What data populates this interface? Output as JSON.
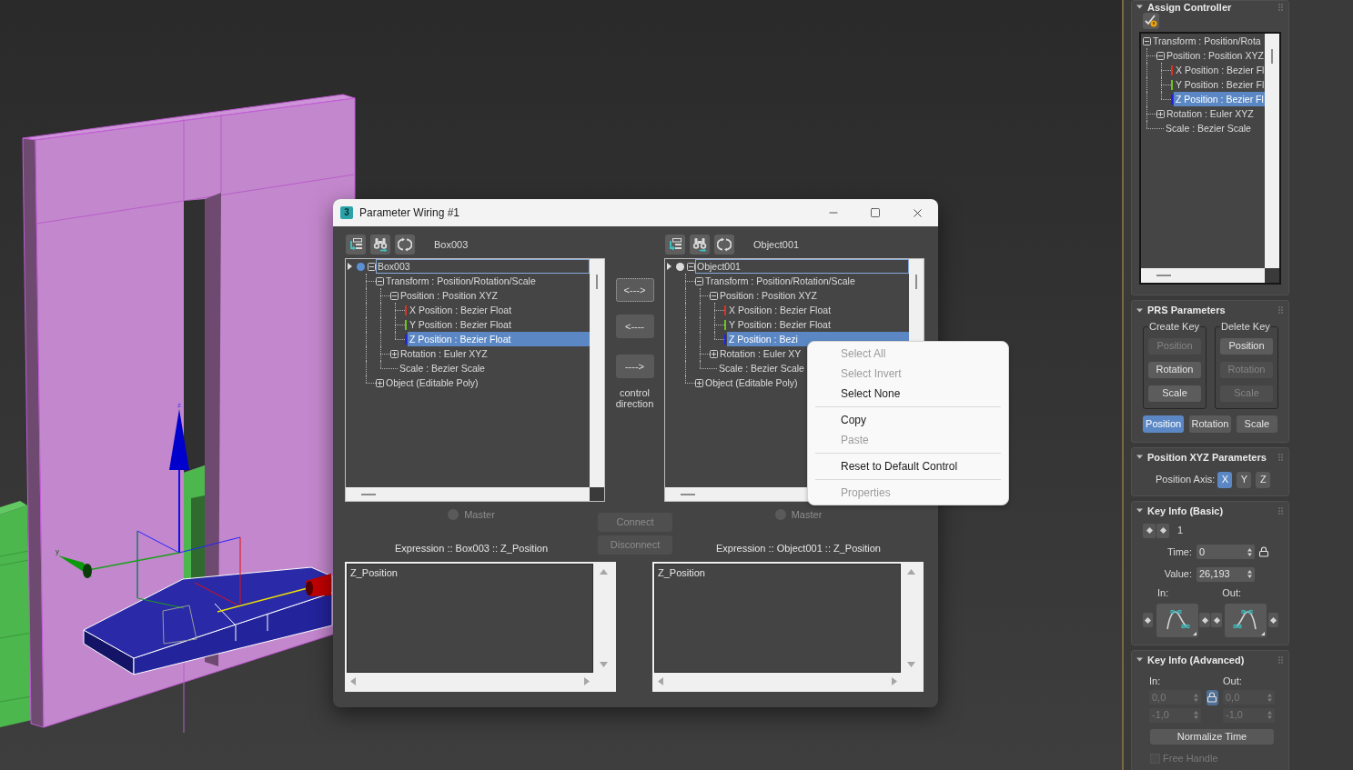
{
  "viewport": {
    "gizmo_labels": [
      "z",
      "y"
    ]
  },
  "dialog": {
    "app_icon": "3",
    "title": "Parameter Wiring #1",
    "panes": [
      {
        "object_name": "Box003",
        "tree": {
          "label": "Box003",
          "kind": "object",
          "color": "#5b8fd6",
          "expanded": true,
          "selected": false,
          "focused": true,
          "children": [
            {
              "label": "Transform : Position/Rotation/Scale",
              "kind": "group",
              "expanded": true,
              "selected": false,
              "focused": false,
              "children": [
                {
                  "label": "Position : Position XYZ",
                  "kind": "group",
                  "expanded": true,
                  "selected": false,
                  "focused": false,
                  "children": [
                    {
                      "label": "X Position : Bezier Float",
                      "kind": "axis",
                      "color": "#e0301e",
                      "selected": false,
                      "focused": false
                    },
                    {
                      "label": "Y Position : Bezier Float",
                      "kind": "axis",
                      "color": "#6ec21e",
                      "selected": false,
                      "focused": false
                    },
                    {
                      "label": "Z Position : Bezier Float",
                      "kind": "axis",
                      "color": "#1e1eff",
                      "selected": true,
                      "focused": false
                    }
                  ]
                },
                {
                  "label": "Rotation : Euler XYZ",
                  "kind": "group",
                  "expanded": false,
                  "selected": false,
                  "focused": false
                },
                {
                  "label": "Scale : Bezier Scale",
                  "kind": "leaf",
                  "selected": false,
                  "focused": false
                }
              ]
            },
            {
              "label": "Object (Editable Poly)",
              "kind": "group",
              "expanded": false,
              "selected": false,
              "focused": false
            }
          ]
        },
        "master": {
          "label": "Master",
          "selected": false,
          "disabled": true
        },
        "expression_label": "Expression :: Box003 :: Z_Position",
        "expression": "Z_Position"
      },
      {
        "object_name": "Object001",
        "tree": {
          "label": "Object001",
          "kind": "object",
          "color": "#dcdcdc",
          "expanded": true,
          "selected": false,
          "focused": true,
          "children": [
            {
              "label": "Transform : Position/Rotation/Scale",
              "kind": "group",
              "expanded": true,
              "selected": false,
              "focused": false,
              "children": [
                {
                  "label": "Position : Position XYZ",
                  "kind": "group",
                  "expanded": true,
                  "selected": false,
                  "focused": false,
                  "children": [
                    {
                      "label": "X Position : Bezier Float",
                      "kind": "axis",
                      "color": "#e0301e",
                      "selected": false,
                      "focused": false
                    },
                    {
                      "label": "Y Position : Bezier Float",
                      "kind": "axis",
                      "color": "#6ec21e",
                      "selected": false,
                      "focused": false
                    },
                    {
                      "label": "Z Position : Bezi",
                      "kind": "axis",
                      "color": "#1e1eff",
                      "selected": true,
                      "focused": false
                    }
                  ]
                },
                {
                  "label": "Rotation : Euler XY",
                  "kind": "group",
                  "expanded": false,
                  "selected": false,
                  "focused": false
                },
                {
                  "label": "Scale : Bezier Scale",
                  "kind": "leaf",
                  "selected": false,
                  "focused": false
                }
              ]
            },
            {
              "label": "Object (Editable Poly)",
              "kind": "group",
              "expanded": false,
              "selected": false,
              "focused": false
            }
          ]
        },
        "master": {
          "label": "Master",
          "selected": false,
          "disabled": true
        },
        "expression_label": "Expression :: Object001 :: Z_Position",
        "expression": "Z_Position"
      }
    ],
    "direction_buttons": [
      {
        "label": "<--->",
        "focused": true
      },
      {
        "label": "<----",
        "focused": false
      },
      {
        "label": "---->",
        "focused": false
      }
    ],
    "direction_caption": "control direction",
    "connect_buttons": [
      {
        "label": "Connect",
        "disabled": true
      },
      {
        "label": "Disconnect",
        "disabled": true
      }
    ]
  },
  "context_menu": {
    "items": [
      {
        "kind": "item",
        "label": "Select All",
        "disabled": true
      },
      {
        "kind": "item",
        "label": "Select Invert",
        "disabled": true
      },
      {
        "kind": "item",
        "label": "Select None",
        "disabled": false
      },
      {
        "kind": "separator"
      },
      {
        "kind": "item",
        "label": "Copy",
        "disabled": false
      },
      {
        "kind": "item",
        "label": "Paste",
        "disabled": true
      },
      {
        "kind": "separator"
      },
      {
        "kind": "item",
        "label": "Reset to Default Control",
        "disabled": false
      },
      {
        "kind": "separator"
      },
      {
        "kind": "item",
        "label": "Properties",
        "disabled": true
      }
    ]
  },
  "command_panel": {
    "rollouts": [
      {
        "kind": "assign_controller",
        "title": "Assign Controller",
        "expanded": true,
        "tree": {
          "label": "Transform : Position/Rota",
          "kind": "group",
          "expanded": true,
          "selected": false,
          "focused": false,
          "children": [
            {
              "label": "Position : Position XYZ",
              "kind": "group",
              "expanded": true,
              "selected": false,
              "focused": false,
              "children": [
                {
                  "label": "X Position : Bezier Fl",
                  "kind": "axis",
                  "color": "#e0301e",
                  "selected": false,
                  "focused": false
                },
                {
                  "label": "Y Position : Bezier Fl",
                  "kind": "axis",
                  "color": "#6ec21e",
                  "selected": false,
                  "focused": false
                },
                {
                  "label": "Z Position : Bezier Fl",
                  "kind": "axis",
                  "color": "#1e1eff",
                  "selected": true,
                  "focused": false
                }
              ]
            },
            {
              "label": "Rotation : Euler XYZ",
              "kind": "group",
              "expanded": false,
              "selected": false,
              "focused": false
            },
            {
              "label": "Scale : Bezier Scale",
              "kind": "leaf",
              "selected": false,
              "focused": false
            }
          ]
        }
      },
      {
        "kind": "prs",
        "title": "PRS Parameters",
        "expanded": true,
        "groups": [
          {
            "label": "Create Key",
            "buttons": [
              {
                "label": "Position",
                "disabled": true
              },
              {
                "label": "Rotation",
                "disabled": false
              },
              {
                "label": "Scale",
                "disabled": false
              }
            ]
          },
          {
            "label": "Delete Key",
            "buttons": [
              {
                "label": "Position",
                "disabled": false
              },
              {
                "label": "Rotation",
                "disabled": true
              },
              {
                "label": "Scale",
                "disabled": true
              }
            ]
          }
        ],
        "modes": [
          {
            "label": "Position",
            "selected": true
          },
          {
            "label": "Rotation",
            "selected": false
          },
          {
            "label": "Scale",
            "selected": false
          }
        ]
      },
      {
        "kind": "position_xyz",
        "title": "Position XYZ Parameters",
        "expanded": true,
        "axis_label": "Position Axis:",
        "axes": [
          {
            "label": "X",
            "selected": true
          },
          {
            "label": "Y",
            "selected": false
          },
          {
            "label": "Z",
            "selected": false
          }
        ]
      },
      {
        "kind": "key_info_basic",
        "title": "Key Info (Basic)",
        "expanded": true,
        "key_number": "1",
        "time_label": "Time:",
        "time": "0",
        "time_locked": false,
        "value_label": "Value:",
        "value": "26,193",
        "in_label": "In:",
        "out_label": "Out:"
      },
      {
        "kind": "key_info_advanced",
        "title": "Key Info (Advanced)",
        "expanded": true,
        "in_label": "In:",
        "out_label": "Out:",
        "locked": true,
        "fields_disabled": true,
        "rows": [
          {
            "in": "0,0",
            "out": "0,0"
          },
          {
            "in": "-1,0",
            "out": "-1,0"
          }
        ],
        "normalize": "Normalize Time",
        "free_handle": {
          "label": "Free Handle",
          "checked": false,
          "disabled": true
        }
      }
    ]
  }
}
